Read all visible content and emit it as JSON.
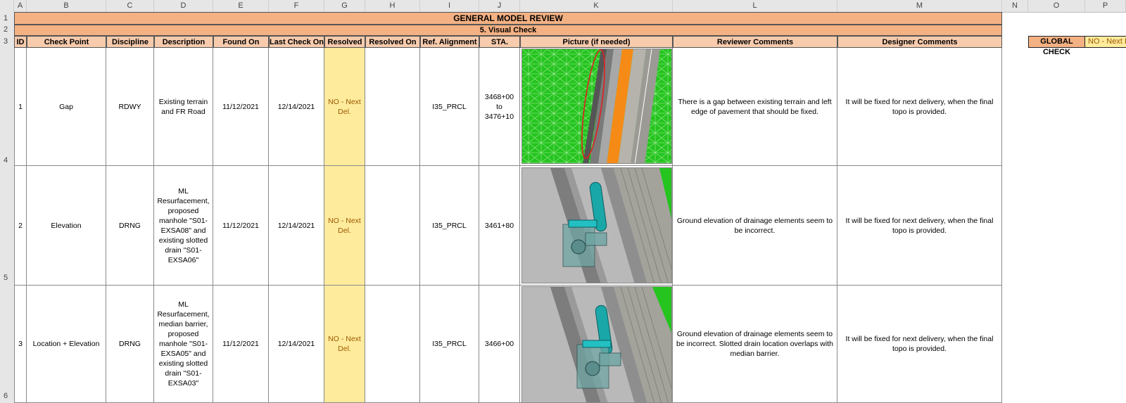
{
  "columns": [
    "A",
    "B",
    "C",
    "D",
    "E",
    "F",
    "G",
    "H",
    "I",
    "J",
    "K",
    "L",
    "M",
    "N",
    "O",
    "P"
  ],
  "rows": [
    "1",
    "2",
    "3",
    "4",
    "5",
    "6"
  ],
  "title": "GENERAL MODEL REVIEW",
  "subtitle": "5. Visual Check",
  "headers": [
    "ID",
    "Check Point",
    "Discipline",
    "Description",
    "Found On",
    "Last Check On",
    "Resolved",
    "Resolved On",
    "Ref. Alignment",
    "STA.",
    "Picture (if needed)",
    "Reviewer Comments",
    "Designer Comments"
  ],
  "global_check": {
    "label": "GLOBAL CHECK",
    "value": "NO - Next Del."
  },
  "colors": {
    "header_band": "#f4b183",
    "header_cells": "#f8cbad",
    "resolved_fill": "#ffeb9c",
    "resolved_text": "#9c5700"
  },
  "records": [
    {
      "id": "1",
      "check_point": "Gap",
      "discipline": "RDWY",
      "description": "Existing terrain and FR Road",
      "found_on": "11/12/2021",
      "last_check_on": "12/14/2021",
      "resolved": "NO - Next Del.",
      "resolved_on": "",
      "ref_alignment": "I35_PRCL",
      "sta": "3468+00 to 3476+10",
      "picture": "terrain-gap-screenshot",
      "reviewer_comments": "There is a gap between existing terrain and left edge of pavement that should be fixed.",
      "designer_comments": "It will be fixed for next delivery, when the final topo is provided."
    },
    {
      "id": "2",
      "check_point": "Elevation",
      "discipline": "DRNG",
      "description": "ML Resurfacement, proposed manhole \"S01-EXSA08\" and existing slotted drain \"S01-EXSA06\"",
      "found_on": "11/12/2021",
      "last_check_on": "12/14/2021",
      "resolved": "NO - Next Del.",
      "resolved_on": "",
      "ref_alignment": "I35_PRCL",
      "sta": "3461+80",
      "picture": "drainage-elevation-screenshot",
      "reviewer_comments": "Ground elevation of drainage elements seem to be incorrect.",
      "designer_comments": "It will be fixed for next delivery, when the final topo is provided."
    },
    {
      "id": "3",
      "check_point": "Location + Elevation",
      "discipline": "DRNG",
      "description": "ML Resurfacement, median barrier, proposed manhole \"S01-EXSA05\" and existing slotted drain \"S01-EXSA03\"",
      "found_on": "11/12/2021",
      "last_check_on": "12/14/2021",
      "resolved": "NO - Next Del.",
      "resolved_on": "",
      "ref_alignment": "I35_PRCL",
      "sta": "3466+00",
      "picture": "drainage-location-screenshot",
      "reviewer_comments": "Ground elevation of drainage elements seem to be incorrect. Slotted drain location overlaps with median barrier.",
      "designer_comments": "It will be fixed for next delivery, when the final topo is provided."
    }
  ]
}
